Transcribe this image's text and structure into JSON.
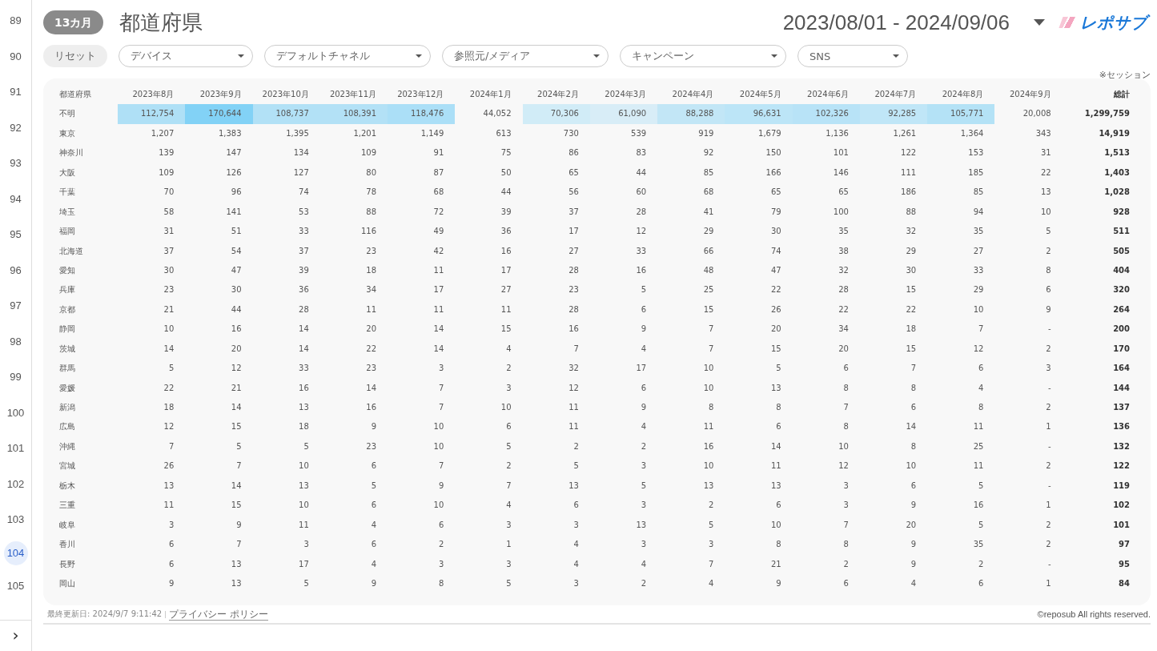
{
  "page_gutter": {
    "pages": [
      {
        "label": "89",
        "selected": false
      },
      {
        "label": "90",
        "selected": false
      },
      {
        "label": "91",
        "selected": false
      },
      {
        "label": "92",
        "selected": false
      },
      {
        "label": "93",
        "selected": false
      },
      {
        "label": "94",
        "selected": false
      },
      {
        "label": "95",
        "selected": false
      },
      {
        "label": "96",
        "selected": false
      },
      {
        "label": "97",
        "selected": false
      },
      {
        "label": "98",
        "selected": false
      },
      {
        "label": "99",
        "selected": false
      },
      {
        "label": "100",
        "selected": false
      },
      {
        "label": "101",
        "selected": false
      },
      {
        "label": "102",
        "selected": false
      },
      {
        "label": "103",
        "selected": false
      },
      {
        "label": "104",
        "selected": true
      },
      {
        "label": "105",
        "selected": false
      }
    ],
    "expand": "›"
  },
  "header": {
    "period_badge": "13カ月",
    "title": "都道府県",
    "date_range": "2023/08/01 - 2024/09/06",
    "logo": "レポサブ"
  },
  "filters": {
    "reset": "リセット",
    "dropdowns": [
      "デバイス",
      "デフォルトチャネル",
      "参照元/メディア",
      "キャンペーン",
      "SNS"
    ],
    "note": "※セッション"
  },
  "table": {
    "columns": [
      "都道府県",
      "2023年8月",
      "2023年9月",
      "2023年10月",
      "2023年11月",
      "2023年12月",
      "2024年1月",
      "2024年2月",
      "2024年3月",
      "2024年4月",
      "2024年5月",
      "2024年6月",
      "2024年7月",
      "2024年8月",
      "2024年9月",
      "総計"
    ],
    "rows": [
      [
        "不明",
        "112,754",
        "170,644",
        "108,737",
        "108,391",
        "118,476",
        "44,052",
        "70,306",
        "61,090",
        "88,288",
        "96,631",
        "102,326",
        "92,285",
        "105,771",
        "20,008",
        "1,299,759"
      ],
      [
        "東京",
        "1,207",
        "1,383",
        "1,395",
        "1,201",
        "1,149",
        "613",
        "730",
        "539",
        "919",
        "1,679",
        "1,136",
        "1,261",
        "1,364",
        "343",
        "14,919"
      ],
      [
        "神奈川",
        "139",
        "147",
        "134",
        "109",
        "91",
        "75",
        "86",
        "83",
        "92",
        "150",
        "101",
        "122",
        "153",
        "31",
        "1,513"
      ],
      [
        "大阪",
        "109",
        "126",
        "127",
        "80",
        "87",
        "50",
        "65",
        "44",
        "85",
        "166",
        "146",
        "111",
        "185",
        "22",
        "1,403"
      ],
      [
        "千葉",
        "70",
        "96",
        "74",
        "78",
        "68",
        "44",
        "56",
        "60",
        "68",
        "65",
        "65",
        "186",
        "85",
        "13",
        "1,028"
      ],
      [
        "埼玉",
        "58",
        "141",
        "53",
        "88",
        "72",
        "39",
        "37",
        "28",
        "41",
        "79",
        "100",
        "88",
        "94",
        "10",
        "928"
      ],
      [
        "福岡",
        "31",
        "51",
        "33",
        "116",
        "49",
        "36",
        "17",
        "12",
        "29",
        "30",
        "35",
        "32",
        "35",
        "5",
        "511"
      ],
      [
        "北海道",
        "37",
        "54",
        "37",
        "23",
        "42",
        "16",
        "27",
        "33",
        "66",
        "74",
        "38",
        "29",
        "27",
        "2",
        "505"
      ],
      [
        "愛知",
        "30",
        "47",
        "39",
        "18",
        "11",
        "17",
        "28",
        "16",
        "48",
        "47",
        "32",
        "30",
        "33",
        "8",
        "404"
      ],
      [
        "兵庫",
        "23",
        "30",
        "36",
        "34",
        "17",
        "27",
        "23",
        "5",
        "25",
        "22",
        "28",
        "15",
        "29",
        "6",
        "320"
      ],
      [
        "京都",
        "21",
        "44",
        "28",
        "11",
        "11",
        "11",
        "28",
        "6",
        "15",
        "26",
        "22",
        "22",
        "10",
        "9",
        "264"
      ],
      [
        "静岡",
        "10",
        "16",
        "14",
        "20",
        "14",
        "15",
        "16",
        "9",
        "7",
        "20",
        "34",
        "18",
        "7",
        "-",
        "200"
      ],
      [
        "茨城",
        "14",
        "20",
        "14",
        "22",
        "14",
        "4",
        "7",
        "4",
        "7",
        "15",
        "20",
        "15",
        "12",
        "2",
        "170"
      ],
      [
        "群馬",
        "5",
        "12",
        "33",
        "23",
        "3",
        "2",
        "32",
        "17",
        "10",
        "5",
        "6",
        "7",
        "6",
        "3",
        "164"
      ],
      [
        "愛媛",
        "22",
        "21",
        "16",
        "14",
        "7",
        "3",
        "12",
        "6",
        "10",
        "13",
        "8",
        "8",
        "4",
        "-",
        "144"
      ],
      [
        "新潟",
        "18",
        "14",
        "13",
        "16",
        "7",
        "10",
        "11",
        "9",
        "8",
        "8",
        "7",
        "6",
        "8",
        "2",
        "137"
      ],
      [
        "広島",
        "12",
        "15",
        "18",
        "9",
        "10",
        "6",
        "11",
        "4",
        "11",
        "6",
        "8",
        "14",
        "11",
        "1",
        "136"
      ],
      [
        "沖縄",
        "7",
        "5",
        "5",
        "23",
        "10",
        "5",
        "2",
        "2",
        "16",
        "14",
        "10",
        "8",
        "25",
        "-",
        "132"
      ],
      [
        "宮城",
        "26",
        "7",
        "10",
        "6",
        "7",
        "2",
        "5",
        "3",
        "10",
        "11",
        "12",
        "10",
        "11",
        "2",
        "122"
      ],
      [
        "栃木",
        "13",
        "14",
        "13",
        "5",
        "9",
        "7",
        "13",
        "5",
        "13",
        "13",
        "3",
        "6",
        "5",
        "-",
        "119"
      ],
      [
        "三重",
        "11",
        "15",
        "10",
        "6",
        "10",
        "4",
        "6",
        "3",
        "2",
        "6",
        "3",
        "9",
        "16",
        "1",
        "102"
      ],
      [
        "岐阜",
        "3",
        "9",
        "11",
        "4",
        "6",
        "3",
        "3",
        "13",
        "5",
        "10",
        "7",
        "20",
        "5",
        "2",
        "101"
      ],
      [
        "香川",
        "6",
        "7",
        "3",
        "6",
        "2",
        "1",
        "4",
        "3",
        "3",
        "8",
        "8",
        "9",
        "35",
        "2",
        "97"
      ],
      [
        "長野",
        "6",
        "13",
        "17",
        "4",
        "3",
        "3",
        "4",
        "4",
        "7",
        "21",
        "2",
        "9",
        "2",
        "-",
        "95"
      ],
      [
        "岡山",
        "9",
        "13",
        "5",
        "9",
        "8",
        "5",
        "3",
        "2",
        "4",
        "9",
        "6",
        "4",
        "6",
        "1",
        "84"
      ]
    ]
  },
  "footer": {
    "updated": "最終更新日: 2024/9/7 9:11:42",
    "privacy_link": "プライバシー ポリシー",
    "copyright": "©reposub All rights reserved."
  }
}
